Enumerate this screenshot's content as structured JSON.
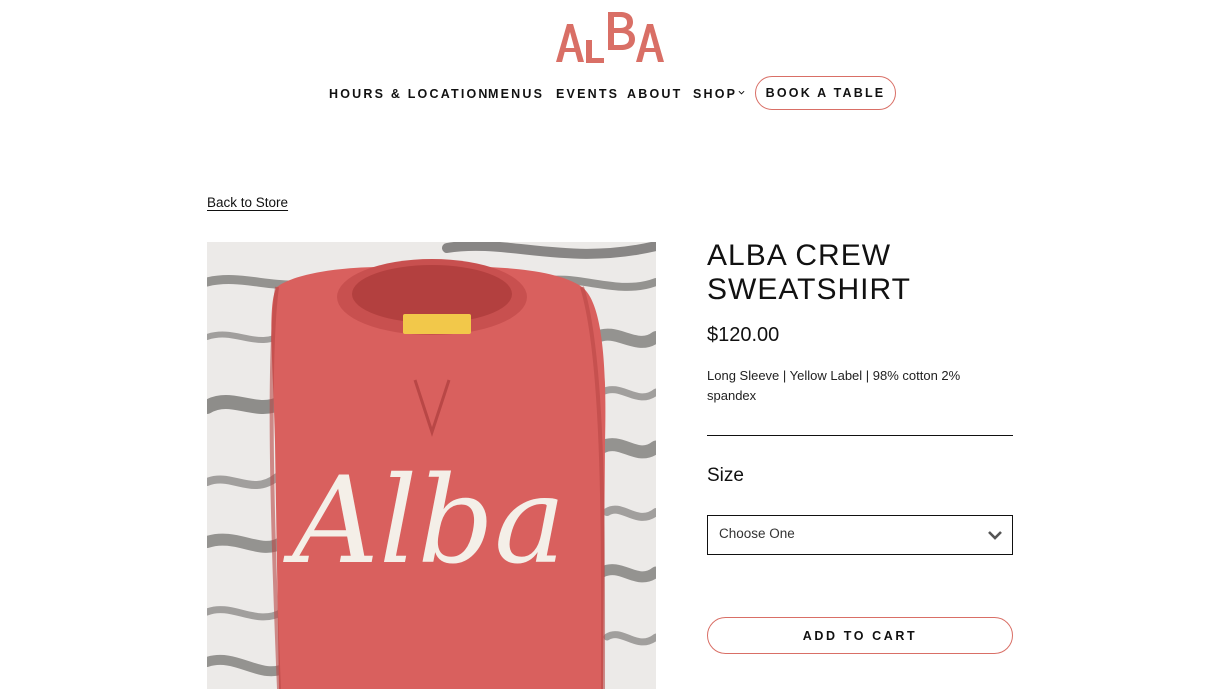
{
  "brand": {
    "logo_text": "ALBA",
    "accent_color": "#d96f66"
  },
  "nav": {
    "items": [
      {
        "label": "HOURS & LOCATION"
      },
      {
        "label": "MENUS"
      },
      {
        "label": "EVENTS"
      },
      {
        "label": "ABOUT"
      },
      {
        "label": "SHOP",
        "icon": "chevron-down-icon"
      }
    ],
    "cta_label": "BOOK A TABLE"
  },
  "back_link": "Back to Store",
  "product": {
    "title": "ALBA CREW SWEATSHIRT",
    "price": "$120.00",
    "description": "Long Sleeve | Yellow Label | 98% cotton 2% spandex",
    "image_text": "Alba",
    "size": {
      "label": "Size",
      "selected": "Choose One"
    },
    "add_to_cart_label": "ADD TO CART"
  }
}
